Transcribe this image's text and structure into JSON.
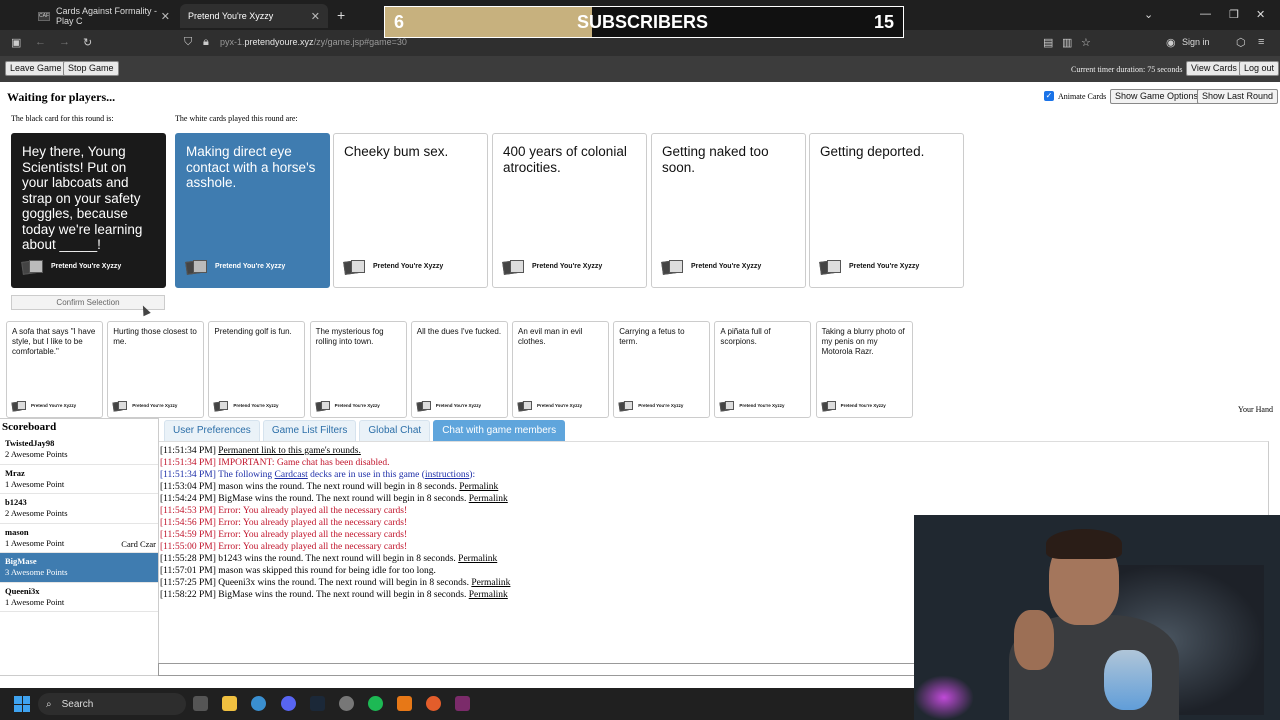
{
  "browser": {
    "tabs": [
      {
        "title": "Cards Against Formality - Play C",
        "favicon": "CAF"
      },
      {
        "title": "Pretend You're Xyzzy"
      }
    ],
    "url_prefix": "pyx-1.",
    "url_domain": "pretendyoure.xyz",
    "url_path": "/zy/game.jsp#game=30",
    "sign_in": "Sign in"
  },
  "overlay": {
    "left_value": "6",
    "label": "SUBSCRIBERS",
    "right_value": "15",
    "progress": 0.4,
    "fill_color": "#c7b17e"
  },
  "toolbar": {
    "leave_game": "Leave Game",
    "stop_game": "Stop Game",
    "timer_text": "Current timer duration: 75 seconds",
    "view_cards": "View Cards",
    "log_out": "Log out"
  },
  "game": {
    "status": "Waiting for players...",
    "animate_cards": "Animate Cards",
    "show_game_options": "Show Game Options",
    "show_last_round": "Show Last Round",
    "black_card_label": "The black card for this round is:",
    "white_cards_label": "The white cards played this round are:",
    "black_card": {
      "text": "Hey there, Young Scientists! Put on your labcoats and strap on your safety goggles, because today we're learning about _____!",
      "footer": "Pretend You're Xyzzy"
    },
    "played_cards": [
      {
        "text": "Making direct eye contact with a horse's asshole.",
        "footer": "Pretend You're Xyzzy"
      },
      {
        "text": "Cheeky bum sex.",
        "footer": "Pretend You're Xyzzy"
      },
      {
        "text": "400 years of colonial atrocities.",
        "footer": "Pretend You're Xyzzy"
      },
      {
        "text": "Getting naked too soon.",
        "footer": "Pretend You're Xyzzy"
      },
      {
        "text": "Getting deported.",
        "footer": "Pretend You're Xyzzy"
      }
    ],
    "confirm_selection": "Confirm Selection",
    "your_hand_label": "Your Hand",
    "hand": [
      {
        "text": "A sofa that says \"I have style, but I like to be comfortable.\"",
        "footer": "Pretend You're Xyzzy"
      },
      {
        "text": "Hurting those closest to me.",
        "footer": "Pretend You're Xyzzy"
      },
      {
        "text": "Pretending golf is fun.",
        "footer": "Pretend You're Xyzzy"
      },
      {
        "text": "The mysterious fog rolling into town.",
        "footer": "Pretend You're Xyzzy"
      },
      {
        "text": "All the dues I've fucked.",
        "footer": "Pretend You're Xyzzy"
      },
      {
        "text": "An evil man in evil clothes.",
        "footer": "Pretend You're Xyzzy"
      },
      {
        "text": "Carrying a fetus to term.",
        "footer": "Pretend You're Xyzzy"
      },
      {
        "text": "A piñata full of scorpions.",
        "footer": "Pretend You're Xyzzy"
      },
      {
        "text": "Taking a blurry photo of my penis on my Motorola Razr.",
        "footer": "Pretend You're Xyzzy"
      }
    ]
  },
  "scoreboard": {
    "title": "Scoreboard",
    "players": [
      {
        "name": "TwistedJay98",
        "points": "2 Awesome Points",
        "status": ""
      },
      {
        "name": "Mraz",
        "points": "1 Awesome Point",
        "status": ""
      },
      {
        "name": "b1243",
        "points": "2 Awesome Points",
        "status": ""
      },
      {
        "name": "mason",
        "points": "1 Awesome Point",
        "status": "Card Czar"
      },
      {
        "name": "BigMase",
        "points": "3 Awesome Points",
        "status": ""
      },
      {
        "name": "Queeni3x",
        "points": "1 Awesome Point",
        "status": ""
      }
    ]
  },
  "chat_tabs": [
    "User Preferences",
    "Game List Filters",
    "Global Chat",
    "Chat with game members"
  ],
  "chat": [
    {
      "time": "[11:51:34 PM]",
      "parts": [
        {
          "t": "Permanent link to this game's rounds.",
          "u": true
        }
      ],
      "color": "default"
    },
    {
      "time": "[11:51:34 PM]",
      "parts": [
        {
          "t": "IMPORTANT: Game chat has been disabled."
        }
      ],
      "color": "red"
    },
    {
      "time": "[11:51:34 PM]",
      "parts": [
        {
          "t": "The following "
        },
        {
          "t": "Cardcast",
          "u": true
        },
        {
          "t": " decks are in use in this game ("
        },
        {
          "t": "instructions",
          "u": true
        },
        {
          "t": "):"
        }
      ],
      "color": "blue"
    },
    {
      "time": "[11:53:04 PM]",
      "parts": [
        {
          "t": "mason wins the round. The next round will begin in 8 seconds. "
        },
        {
          "t": "Permalink",
          "u": true
        }
      ],
      "color": "default"
    },
    {
      "time": "[11:54:24 PM]",
      "parts": [
        {
          "t": "BigMase wins the round. The next round will begin in 8 seconds. "
        },
        {
          "t": "Permalink",
          "u": true
        }
      ],
      "color": "default"
    },
    {
      "time": "[11:54:53 PM]",
      "parts": [
        {
          "t": "Error: You already played all the necessary cards!"
        }
      ],
      "color": "red"
    },
    {
      "time": "[11:54:56 PM]",
      "parts": [
        {
          "t": "Error: You already played all the necessary cards!"
        }
      ],
      "color": "red"
    },
    {
      "time": "[11:54:59 PM]",
      "parts": [
        {
          "t": "Error: You already played all the necessary cards!"
        }
      ],
      "color": "red"
    },
    {
      "time": "[11:55:00 PM]",
      "parts": [
        {
          "t": "Error: You already played all the necessary cards!"
        }
      ],
      "color": "red"
    },
    {
      "time": "[11:55:28 PM]",
      "parts": [
        {
          "t": "b1243 wins the round. The next round will begin in 8 seconds. "
        },
        {
          "t": "Permalink",
          "u": true
        }
      ],
      "color": "default"
    },
    {
      "time": "[11:57:01 PM]",
      "parts": [
        {
          "t": "mason was skipped this round for being idle for too long."
        }
      ],
      "color": "default"
    },
    {
      "time": "[11:57:25 PM]",
      "parts": [
        {
          "t": "Queeni3x wins the round. The next round will begin in 8 seconds. "
        },
        {
          "t": "Permalink",
          "u": true
        }
      ],
      "color": "default"
    },
    {
      "time": "[11:58:22 PM]",
      "parts": [
        {
          "t": "BigMase wins the round. The next round will begin in 8 seconds. "
        },
        {
          "t": "Permalink",
          "u": true
        }
      ],
      "color": "default"
    }
  ],
  "taskbar": {
    "search": "Search"
  }
}
